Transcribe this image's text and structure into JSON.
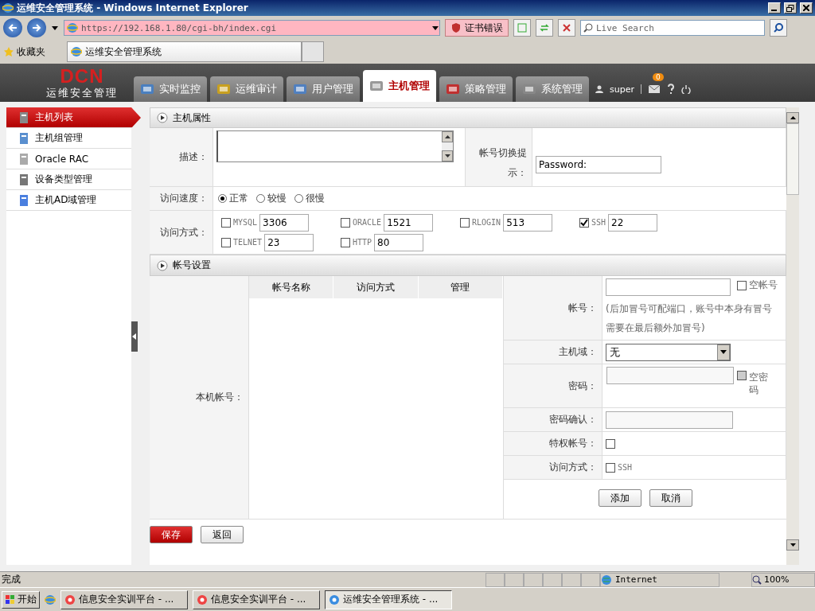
{
  "window": {
    "title": "运维安全管理系统 - Windows Internet Explorer"
  },
  "address_bar": {
    "url": "https://192.168.1.80/cgi-bh/index.cgi",
    "cert_error": "证书错误",
    "search_placeholder": "Live Search"
  },
  "favorites": {
    "label": "收藏夹",
    "tab": "运维安全管理系统"
  },
  "app": {
    "logo": "DCN",
    "logo_subtitle": "运维安全管理",
    "user": "super",
    "badge": "0",
    "nav_tabs": [
      {
        "label": "实时监控",
        "selected": false
      },
      {
        "label": "运维审计",
        "selected": false
      },
      {
        "label": "用户管理",
        "selected": false
      },
      {
        "label": "主机管理",
        "selected": true
      },
      {
        "label": "策略管理",
        "selected": false
      },
      {
        "label": "系统管理",
        "selected": false
      }
    ]
  },
  "sidebar": {
    "items": [
      {
        "label": "主机列表",
        "selected": true
      },
      {
        "label": "主机组管理",
        "selected": false
      },
      {
        "label": "Oracle RAC",
        "selected": false
      },
      {
        "label": "设备类型管理",
        "selected": false
      },
      {
        "label": "主机AD域管理",
        "selected": false
      }
    ]
  },
  "host_section": {
    "title": "主机属性",
    "description_label": "描述：",
    "switch_hint_label": "帐号切换提示：",
    "switch_hint": {
      "value": "Password:"
    },
    "speed_label": "访问速度：",
    "speed_options": [
      {
        "label": "正常",
        "selected": true
      },
      {
        "label": "较慢",
        "selected": false
      },
      {
        "label": "很慢",
        "selected": false
      }
    ],
    "access_label": "访问方式：",
    "protocols": [
      {
        "name": "MYSQL",
        "port": "3306",
        "checked": false
      },
      {
        "name": "ORACLE",
        "port": "1521",
        "checked": false
      },
      {
        "name": "RLOGIN",
        "port": "513",
        "checked": false
      },
      {
        "name": "SSH",
        "port": "22",
        "checked": true
      },
      {
        "name": "TELNET",
        "port": "23",
        "checked": false
      },
      {
        "name": "HTTP",
        "port": "80",
        "checked": false
      }
    ]
  },
  "account_section": {
    "title": "帐号设置",
    "local_label": "本机帐号：",
    "columns": [
      "帐号名称",
      "访问方式",
      "管理"
    ],
    "account_label": "帐号：",
    "empty_account": {
      "label": "空帐号",
      "checked": false
    },
    "account_hint": "(后加冒号可配端口，账号中本身有冒号需要在最后额外加冒号)",
    "domain_label": "主机域：",
    "domain_value": "无",
    "password_label": "密码：",
    "empty_password": {
      "label": "空密码",
      "checked": false,
      "disabled": true
    },
    "confirm_label": "密码确认：",
    "privileged_label": "特权帐号：",
    "privileged": {
      "checked": false
    },
    "access_label": "访问方式：",
    "access_options": [
      {
        "label": "SSH",
        "checked": false
      }
    ],
    "add": "添加",
    "cancel": "取消"
  },
  "buttons": {
    "save": "保存",
    "back": "返回"
  },
  "status_bar": {
    "text": "完成",
    "zone": "Internet",
    "zoom": "100%"
  },
  "taskbar": {
    "start": "开始",
    "items": [
      {
        "label": "信息安全实训平台 - ...",
        "selected": false
      },
      {
        "label": "信息安全实训平台 - ...",
        "selected": false
      },
      {
        "label": "运维安全管理系统 - ...",
        "selected": true
      }
    ]
  }
}
